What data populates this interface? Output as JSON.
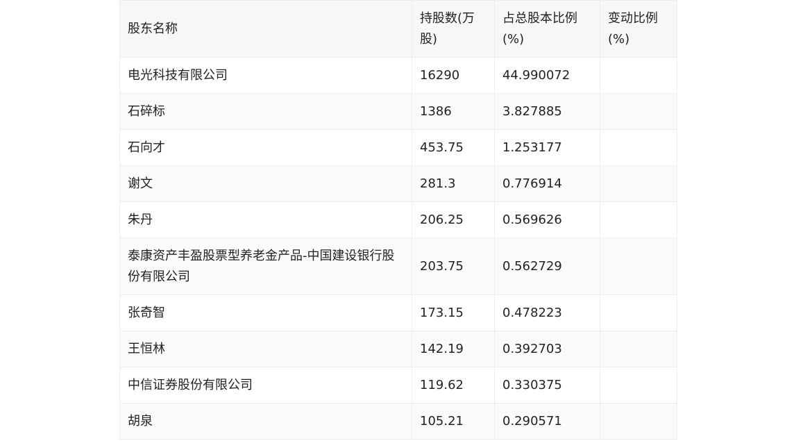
{
  "table": {
    "headers": [
      "股东名称",
      "持股数(万股)",
      "占总股本比例(%)",
      "变动比例(%)"
    ],
    "rows": [
      {
        "name": "电光科技有限公司",
        "shares": "16290",
        "ratio": "44.990072",
        "change": ""
      },
      {
        "name": "石碎标",
        "shares": "1386",
        "ratio": "3.827885",
        "change": ""
      },
      {
        "name": "石向才",
        "shares": "453.75",
        "ratio": "1.253177",
        "change": ""
      },
      {
        "name": "谢文",
        "shares": "281.3",
        "ratio": "0.776914",
        "change": ""
      },
      {
        "name": "朱丹",
        "shares": "206.25",
        "ratio": "0.569626",
        "change": ""
      },
      {
        "name": "泰康资产丰盈股票型养老金产品-中国建设银行股份有限公司",
        "shares": "203.75",
        "ratio": "0.562729",
        "change": ""
      },
      {
        "name": "张奇智",
        "shares": "173.15",
        "ratio": "0.478223",
        "change": ""
      },
      {
        "name": "王恒林",
        "shares": "142.19",
        "ratio": "0.392703",
        "change": ""
      },
      {
        "name": "中信证券股份有限公司",
        "shares": "119.62",
        "ratio": "0.330375",
        "change": ""
      },
      {
        "name": "胡泉",
        "shares": "105.21",
        "ratio": "0.290571",
        "change": ""
      }
    ]
  }
}
